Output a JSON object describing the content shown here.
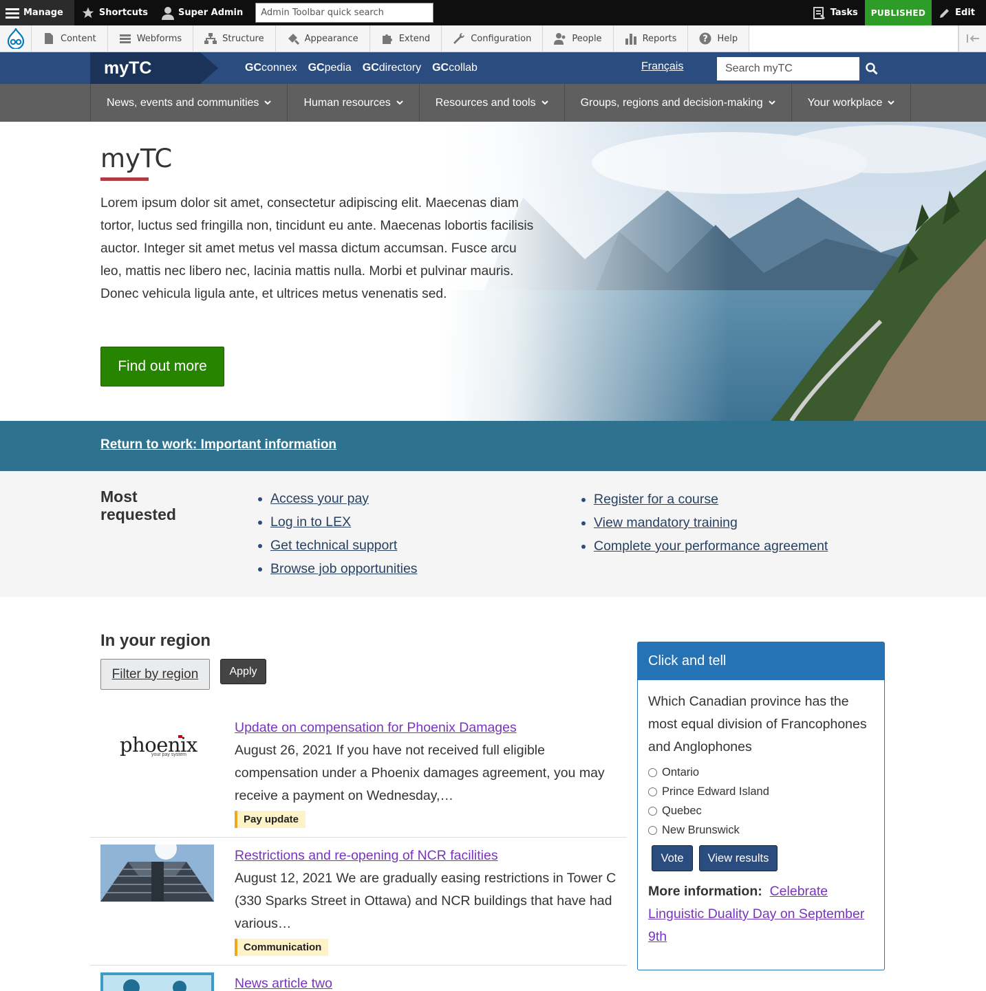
{
  "admin_toolbar": {
    "manage": "Manage",
    "shortcuts": "Shortcuts",
    "user": "Super Admin",
    "search_placeholder": "Admin Toolbar quick search",
    "tasks": "Tasks",
    "status": "PUBLISHED",
    "edit": "Edit"
  },
  "admin_tray": {
    "items": [
      "Content",
      "Webforms",
      "Structure",
      "Appearance",
      "Extend",
      "Configuration",
      "People",
      "Reports",
      "Help"
    ]
  },
  "header": {
    "brand": "myTC",
    "gc_links": [
      {
        "prefix": "GC",
        "suffix": "connex"
      },
      {
        "prefix": "GC",
        "suffix": "pedia"
      },
      {
        "prefix": "GC",
        "suffix": "directory"
      },
      {
        "prefix": "GC",
        "suffix": "collab"
      }
    ],
    "language": "Français",
    "search_placeholder": "Search myTC"
  },
  "nav": {
    "items": [
      "News, events and communities",
      "Human resources",
      "Resources and tools",
      "Groups, regions and decision-making",
      "Your workplace"
    ]
  },
  "hero": {
    "title": "myTC",
    "text": "Lorem ipsum dolor sit amet, consectetur adipiscing elit. Maecenas diam tortor, luctus sed fringilla non, tincidunt eu ante. Maecenas lobortis facilisis auctor. Integer sit amet metus vel massa dictum accumsan. Fusce arcu leo, mattis nec libero nec, lacinia mattis nulla. Morbi et pulvinar mauris. Donec vehicula ligula ante, et ultrices metus venenatis sed.",
    "button": "Find out more"
  },
  "alert": {
    "link": "Return to work: Important information"
  },
  "most_requested": {
    "heading": "Most requested",
    "col1": [
      "Access your pay",
      "Log in to LEX",
      "Get technical support",
      "Browse job opportunities"
    ],
    "col2": [
      "Register for a course",
      "View mandatory training",
      "Complete your performance agreement"
    ]
  },
  "region": {
    "heading": "In your region",
    "filter": "Filter by region",
    "apply": "Apply",
    "news": [
      {
        "title": "Update on compensation for Phoenix Damages",
        "body": "August 26, 2021 If you have not received full eligible compensation under a Phoenix damages agreement, you may receive a payment on Wednesday,…",
        "tag": "Pay update",
        "thumb_logo": "phoenix",
        "thumb_sub": "your pay system"
      },
      {
        "title": "Restrictions and re-opening of NCR facilities",
        "body": "August 12, 2021 We are gradually easing restrictions in Tower C (330 Sparks Street in Ottawa) and NCR buildings that have had various…",
        "tag": "Communication"
      },
      {
        "title": "News article two"
      }
    ]
  },
  "poll": {
    "heading": "Click and tell",
    "question": "Which Canadian province has the most equal division of Francophones and Anglophones",
    "options": [
      "Ontario",
      "Prince Edward Island",
      "Quebec",
      "New Brunswick"
    ],
    "vote": "Vote",
    "results": "View results",
    "more_label": "More information:",
    "more_link": "Celebrate Linguistic Duality Day on September 9th"
  },
  "colors": {
    "header_blue": "#2b4c7e",
    "nav_gray": "#5f5f5f",
    "accent_red": "#af3c43",
    "cta_green": "#278400",
    "alert_teal": "#2f728f",
    "published_green": "#2e9d28",
    "visited_purple": "#7834bc"
  }
}
